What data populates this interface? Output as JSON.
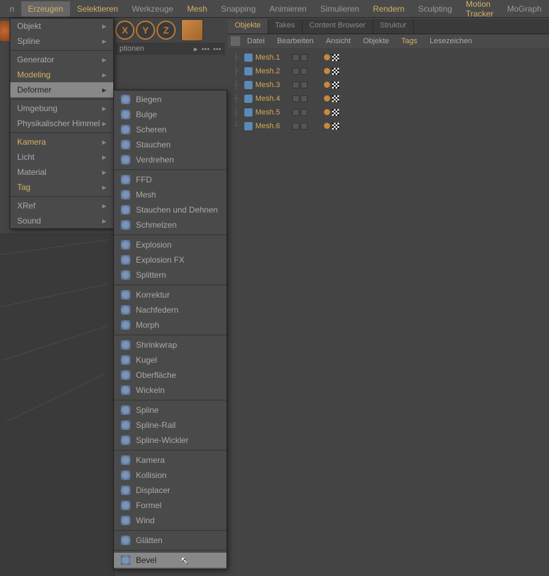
{
  "menubar": {
    "items": [
      {
        "label": "n",
        "active": false,
        "highlight": false
      },
      {
        "label": "Erzeugen",
        "active": true,
        "highlight": false
      },
      {
        "label": "Selektieren",
        "active": false,
        "highlight": true
      },
      {
        "label": "Werkzeuge",
        "active": false,
        "highlight": false
      },
      {
        "label": "Mesh",
        "active": false,
        "highlight": true
      },
      {
        "label": "Snapping",
        "active": false,
        "highlight": false
      },
      {
        "label": "Animieren",
        "active": false,
        "highlight": false
      },
      {
        "label": "Simulieren",
        "active": false,
        "highlight": false
      },
      {
        "label": "Rendern",
        "active": false,
        "highlight": true
      },
      {
        "label": "Sculpting",
        "active": false,
        "highlight": false
      },
      {
        "label": "Motion Tracker",
        "active": false,
        "highlight": true
      },
      {
        "label": "MoGraph",
        "active": false,
        "highlight": false
      }
    ]
  },
  "dropdown": {
    "groups": [
      [
        {
          "label": "Objekt",
          "highlight": false
        },
        {
          "label": "Spline",
          "highlight": false
        }
      ],
      [
        {
          "label": "Generator",
          "highlight": false
        },
        {
          "label": "Modeling",
          "highlight": true
        },
        {
          "label": "Deformer",
          "highlight": false,
          "selected": true
        }
      ],
      [
        {
          "label": "Umgebung",
          "highlight": false
        },
        {
          "label": "Physikalischer Himmel",
          "highlight": false
        }
      ],
      [
        {
          "label": "Kamera",
          "highlight": true
        },
        {
          "label": "Licht",
          "highlight": false
        },
        {
          "label": "Material",
          "highlight": false
        },
        {
          "label": "Tag",
          "highlight": true
        }
      ],
      [
        {
          "label": "XRef",
          "highlight": false
        },
        {
          "label": "Sound",
          "highlight": false
        }
      ]
    ]
  },
  "submenu": {
    "groups": [
      [
        "Biegen",
        "Bulge",
        "Scheren",
        "Stauchen",
        "Verdrehen"
      ],
      [
        "FFD",
        "Mesh",
        "Stauchen und Dehnen",
        "Schmelzen"
      ],
      [
        "Explosion",
        "Explosion FX",
        "Splittern"
      ],
      [
        "Korrektur",
        "Nachfedern",
        "Morph"
      ],
      [
        "Shrinkwrap",
        "Kugel",
        "Oberfläche",
        "Wickeln"
      ],
      [
        "Spline",
        "Spline-Rail",
        "Spline-Wickler"
      ],
      [
        "Kamera",
        "Kollision",
        "Displacer",
        "Formel",
        "Wind"
      ],
      [
        "Glätten"
      ],
      [
        "Bevel"
      ]
    ],
    "hovered": "Bevel"
  },
  "axes": [
    "X",
    "Y",
    "Z"
  ],
  "toolbar2": {
    "label": "ptionen",
    "arrow": "▸"
  },
  "object_panel": {
    "tabs": [
      {
        "label": "Objekte",
        "active": true
      },
      {
        "label": "Takes",
        "active": false
      },
      {
        "label": "Content Browser",
        "active": false
      },
      {
        "label": "Struktur",
        "active": false
      }
    ],
    "menu": [
      {
        "label": "Datei",
        "highlight": false
      },
      {
        "label": "Bearbeiten",
        "highlight": false
      },
      {
        "label": "Ansicht",
        "highlight": false
      },
      {
        "label": "Objekte",
        "highlight": false
      },
      {
        "label": "Tags",
        "highlight": true
      },
      {
        "label": "Lesezeichen",
        "highlight": false
      }
    ],
    "items": [
      "Mesh.1",
      "Mesh.2",
      "Mesh.3",
      "Mesh.4",
      "Mesh.5",
      "Mesh.6"
    ]
  }
}
